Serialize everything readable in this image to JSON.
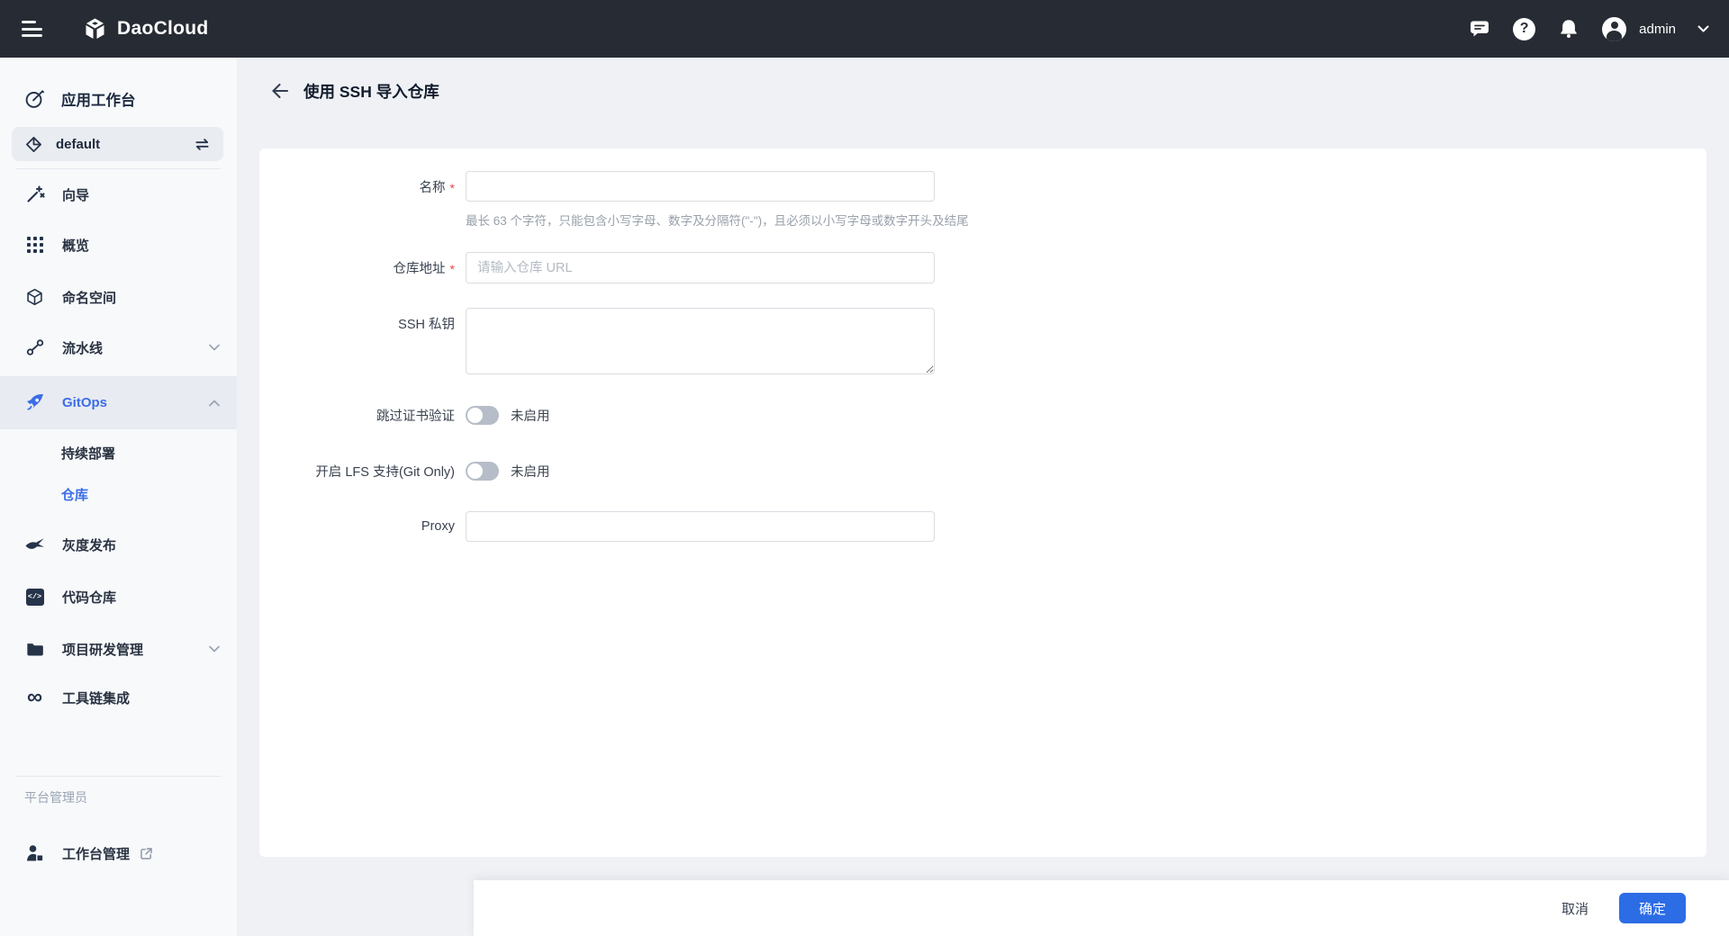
{
  "topbar": {
    "brand": "DaoCloud",
    "user": {
      "name": "admin"
    },
    "icons": {
      "menu": "menu-icon",
      "logo": "daocloud-logo",
      "message": "message-icon",
      "help": "help-icon",
      "help_glyph": "?",
      "bell": "bell-icon",
      "avatar": "avatar",
      "chevron": "chevron-down-icon"
    }
  },
  "sidebar": {
    "header": {
      "label": "应用工作台",
      "icon": "workbench-icon"
    },
    "workspace": {
      "label": "default",
      "icon": "workspace-icon",
      "switch_icon": "switch-workspace-icon"
    },
    "items": [
      {
        "label": "向导",
        "icon": "wand-icon"
      },
      {
        "label": "概览",
        "icon": "grid-icon"
      },
      {
        "label": "命名空间",
        "icon": "namespace-cube-icon"
      },
      {
        "label": "流水线",
        "icon": "pipeline-icon",
        "chevron": "down"
      },
      {
        "label": "GitOps",
        "icon": "rocket-icon",
        "chevron": "up",
        "active": true
      },
      {
        "label": "持续部署",
        "child": true
      },
      {
        "label": "仓库",
        "child": true,
        "active": true
      },
      {
        "label": "灰度发布",
        "icon": "bird-icon"
      },
      {
        "label": "代码仓库",
        "icon": "code-repo-icon",
        "glyph": "</>"
      },
      {
        "label": "项目研发管理",
        "icon": "folder-icon",
        "chevron": "down"
      },
      {
        "label": "工具链集成",
        "icon": "infinity-icon",
        "glyph": "∞"
      }
    ],
    "section_label": "平台管理员",
    "admin_item": {
      "label": "工作台管理",
      "icon": "admin-workbench-icon",
      "external_icon": "external-link-icon"
    }
  },
  "page": {
    "title": "使用 SSH 导入仓库",
    "back_icon": "back-arrow-icon"
  },
  "form": {
    "required_mark": "*",
    "fields": {
      "name": {
        "label": "名称",
        "required": true,
        "value": "",
        "helper": "最长 63 个字符，只能包含小写字母、数字及分隔符(\"-\")，且必须以小写字母或数字开头及结尾"
      },
      "repo_url": {
        "label": "仓库地址",
        "required": true,
        "value": "",
        "placeholder": "请输入仓库 URL"
      },
      "ssh_key": {
        "label": "SSH 私钥",
        "value": ""
      },
      "skip_cert_verify": {
        "label": "跳过证书验证",
        "enabled": false,
        "state_label": "未启用"
      },
      "lfs_support": {
        "label": "开启 LFS 支持(Git Only)",
        "enabled": false,
        "state_label": "未启用"
      },
      "proxy": {
        "label": "Proxy",
        "value": ""
      }
    }
  },
  "footer": {
    "cancel_label": "取消",
    "confirm_label": "确定"
  },
  "colors": {
    "topbar_bg": "#272c34",
    "sidebar_bg": "#f7f9fb",
    "main_bg": "#eff1f5",
    "active_blue": "#3b6de8",
    "primary_button": "#2c6ce5",
    "required_red": "#e5484d",
    "toggle_off": "#b6bdc8"
  }
}
